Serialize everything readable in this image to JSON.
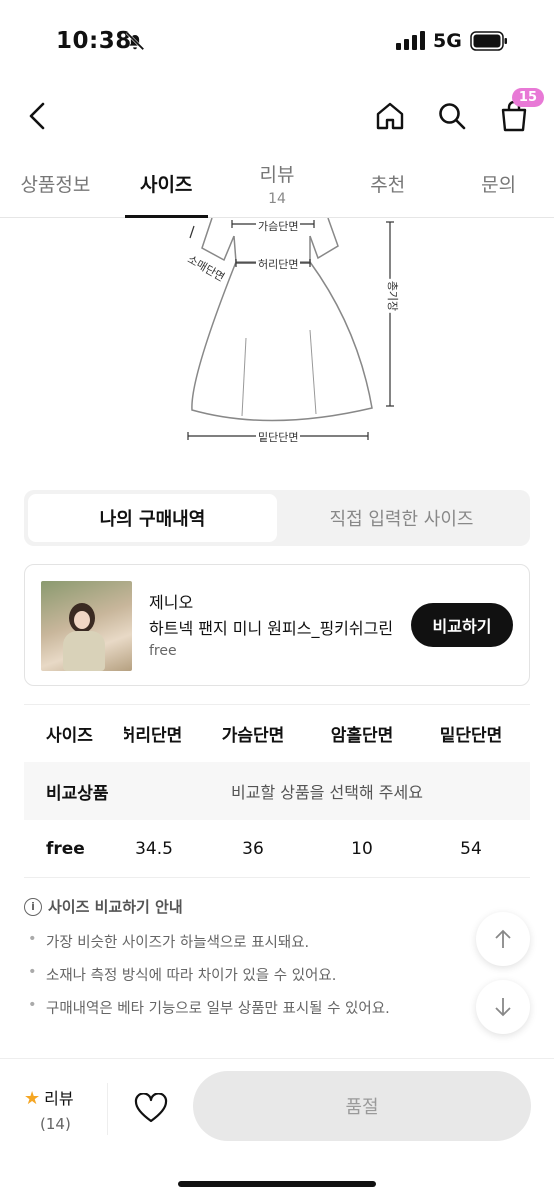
{
  "status": {
    "time": "10:38",
    "network": "5G"
  },
  "header": {
    "cart_count": "15"
  },
  "tabs": [
    {
      "label": "상품정보",
      "count": ""
    },
    {
      "label": "사이즈",
      "count": ""
    },
    {
      "label": "리뷰",
      "count": "14"
    },
    {
      "label": "추천",
      "count": ""
    },
    {
      "label": "문의",
      "count": ""
    }
  ],
  "diagram": {
    "chest": "가슴단면",
    "waist": "허리단면",
    "sleeve": "소매단면",
    "length": "총기장",
    "hem": "밑단단면"
  },
  "segment": {
    "history": "나의 구매내역",
    "manual": "직접 입력한 사이즈"
  },
  "purchase": {
    "brand": "제니오",
    "name": "하트넥 팬지 미니 원피스_핑키쉬그린",
    "size": "free",
    "compare_button": "비교하기"
  },
  "table": {
    "headers": [
      "사이즈",
      "허리단면",
      "가슴단면",
      "암홀단면",
      "밑단단면"
    ],
    "compare_label": "비교상품",
    "compare_message": "비교할 상품을 선택해 주세요",
    "rows": [
      {
        "size": "free",
        "values": [
          "34.5",
          "36",
          "10",
          "54"
        ]
      }
    ]
  },
  "info": {
    "title": "사이즈 비교하기 안내",
    "items": [
      "가장 비슷한 사이즈가 하늘색으로 표시돼요.",
      "소재나 측정 방식에 따라 차이가 있을 수 있어요.",
      "구매내역은 베타 기능으로 일부 상품만 표시될 수 있어요."
    ]
  },
  "bottom": {
    "review_label": "리뷰",
    "review_count": "(14)",
    "buy_label": "품절"
  },
  "colors": {
    "badge": "#e879d6",
    "star": "#f5a623",
    "button": "#111111"
  }
}
